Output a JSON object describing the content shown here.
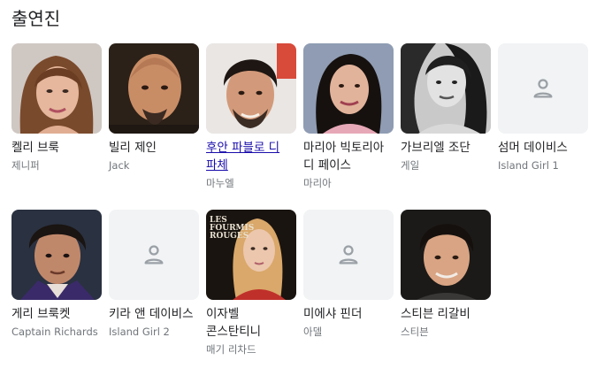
{
  "section": {
    "title": "출연진"
  },
  "cast": [
    {
      "name": "켈리 브룩",
      "role": "제니퍼",
      "link": false
    },
    {
      "name": "빌리 제인",
      "role": "Jack",
      "link": false
    },
    {
      "name": "후안 파블로 디 파체",
      "role": "마누엘",
      "link": true
    },
    {
      "name": "마리아 빅토리아 디 페이스",
      "role": "마리아",
      "link": false
    },
    {
      "name": "가브리엘 조단",
      "role": "게일",
      "link": false
    },
    {
      "name": "섬머 데이비스",
      "role": "Island Girl 1",
      "link": false
    },
    {
      "name": "게리 브룩켓",
      "role": "Captain Richards",
      "link": false
    },
    {
      "name": "키라 앤 데이비스",
      "role": "Island Girl 2",
      "link": false
    },
    {
      "name": "이자벨 콘스탄티니",
      "role": "매기 리차드",
      "link": false
    },
    {
      "name": "미에샤 핀더",
      "role": "아델",
      "link": false
    },
    {
      "name": "스티븐 리갈비",
      "role": "스티븐",
      "link": false
    }
  ],
  "poster_text": {
    "line1": "LES",
    "line2": "FOURMIS",
    "line3": "ROUGES"
  },
  "icons": {
    "placeholder": "person-icon"
  }
}
